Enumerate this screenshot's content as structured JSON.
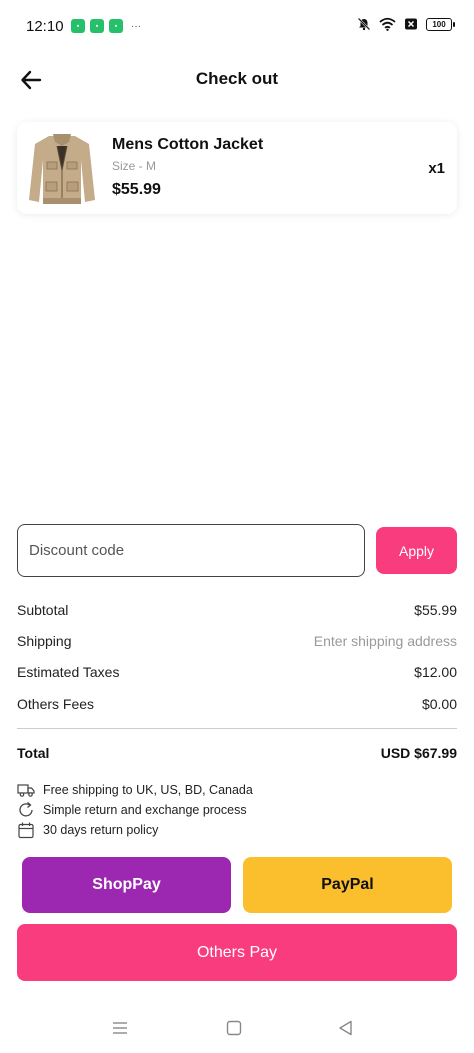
{
  "status_bar": {
    "time": "12:10",
    "battery": "100"
  },
  "header": {
    "title": "Check out"
  },
  "cart": {
    "items": [
      {
        "name": "Mens Cotton Jacket",
        "size": "Size - M",
        "price": "$55.99",
        "quantity": "x1"
      }
    ]
  },
  "discount": {
    "placeholder": "Discount code",
    "apply_label": "Apply"
  },
  "summary": {
    "subtotal_label": "Subtotal",
    "subtotal_value": "$55.99",
    "shipping_label": "Shipping",
    "shipping_value": "Enter shipping address",
    "taxes_label": "Estimated Taxes",
    "taxes_value": "$12.00",
    "fees_label": "Others Fees",
    "fees_value": "$0.00",
    "total_label": "Total",
    "total_value": "USD $67.99"
  },
  "perks": [
    {
      "icon": "truck-icon",
      "text": "Free shipping to UK, US, BD, Canada"
    },
    {
      "icon": "refresh-icon",
      "text": "Simple return and exchange process"
    },
    {
      "icon": "calendar-icon",
      "text": "30 days return policy"
    }
  ],
  "payment": {
    "shoppay_label": "ShopPay",
    "paypal_label": "PayPal",
    "others_label": "Others Pay"
  },
  "colors": {
    "accent": "#f83c7e",
    "shoppay": "#9c27b0",
    "paypal": "#fbbf2d"
  }
}
